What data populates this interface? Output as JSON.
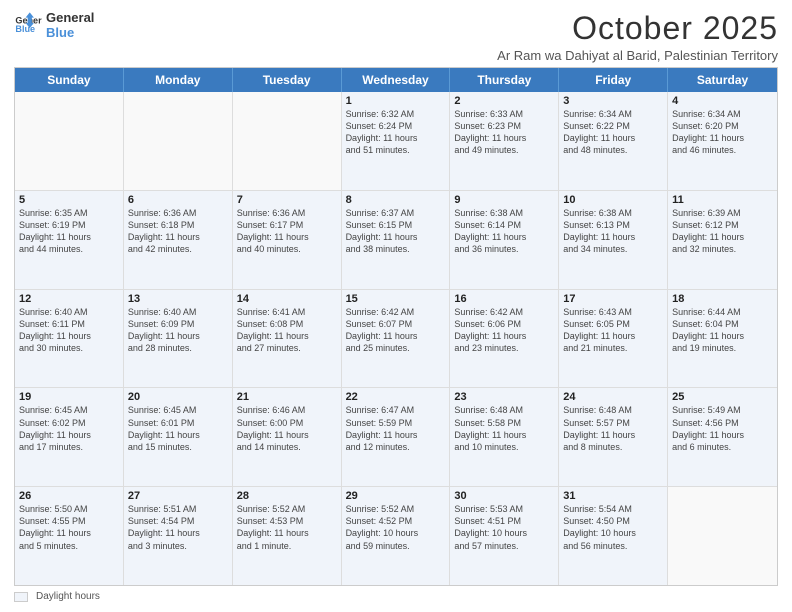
{
  "logo": {
    "line1": "General",
    "line2": "Blue"
  },
  "title": "October 2025",
  "subtitle": "Ar Ram wa Dahiyat al Barid, Palestinian Territory",
  "days_of_week": [
    "Sunday",
    "Monday",
    "Tuesday",
    "Wednesday",
    "Thursday",
    "Friday",
    "Saturday"
  ],
  "legend_label": "Daylight hours",
  "weeks": [
    [
      {
        "day": "",
        "info": "",
        "empty": true
      },
      {
        "day": "",
        "info": "",
        "empty": true
      },
      {
        "day": "",
        "info": "",
        "empty": true
      },
      {
        "day": "1",
        "info": "Sunrise: 6:32 AM\nSunset: 6:24 PM\nDaylight: 11 hours\nand 51 minutes.",
        "empty": false
      },
      {
        "day": "2",
        "info": "Sunrise: 6:33 AM\nSunset: 6:23 PM\nDaylight: 11 hours\nand 49 minutes.",
        "empty": false
      },
      {
        "day": "3",
        "info": "Sunrise: 6:34 AM\nSunset: 6:22 PM\nDaylight: 11 hours\nand 48 minutes.",
        "empty": false
      },
      {
        "day": "4",
        "info": "Sunrise: 6:34 AM\nSunset: 6:20 PM\nDaylight: 11 hours\nand 46 minutes.",
        "empty": false
      }
    ],
    [
      {
        "day": "5",
        "info": "Sunrise: 6:35 AM\nSunset: 6:19 PM\nDaylight: 11 hours\nand 44 minutes.",
        "empty": false
      },
      {
        "day": "6",
        "info": "Sunrise: 6:36 AM\nSunset: 6:18 PM\nDaylight: 11 hours\nand 42 minutes.",
        "empty": false
      },
      {
        "day": "7",
        "info": "Sunrise: 6:36 AM\nSunset: 6:17 PM\nDaylight: 11 hours\nand 40 minutes.",
        "empty": false
      },
      {
        "day": "8",
        "info": "Sunrise: 6:37 AM\nSunset: 6:15 PM\nDaylight: 11 hours\nand 38 minutes.",
        "empty": false
      },
      {
        "day": "9",
        "info": "Sunrise: 6:38 AM\nSunset: 6:14 PM\nDaylight: 11 hours\nand 36 minutes.",
        "empty": false
      },
      {
        "day": "10",
        "info": "Sunrise: 6:38 AM\nSunset: 6:13 PM\nDaylight: 11 hours\nand 34 minutes.",
        "empty": false
      },
      {
        "day": "11",
        "info": "Sunrise: 6:39 AM\nSunset: 6:12 PM\nDaylight: 11 hours\nand 32 minutes.",
        "empty": false
      }
    ],
    [
      {
        "day": "12",
        "info": "Sunrise: 6:40 AM\nSunset: 6:11 PM\nDaylight: 11 hours\nand 30 minutes.",
        "empty": false
      },
      {
        "day": "13",
        "info": "Sunrise: 6:40 AM\nSunset: 6:09 PM\nDaylight: 11 hours\nand 28 minutes.",
        "empty": false
      },
      {
        "day": "14",
        "info": "Sunrise: 6:41 AM\nSunset: 6:08 PM\nDaylight: 11 hours\nand 27 minutes.",
        "empty": false
      },
      {
        "day": "15",
        "info": "Sunrise: 6:42 AM\nSunset: 6:07 PM\nDaylight: 11 hours\nand 25 minutes.",
        "empty": false
      },
      {
        "day": "16",
        "info": "Sunrise: 6:42 AM\nSunset: 6:06 PM\nDaylight: 11 hours\nand 23 minutes.",
        "empty": false
      },
      {
        "day": "17",
        "info": "Sunrise: 6:43 AM\nSunset: 6:05 PM\nDaylight: 11 hours\nand 21 minutes.",
        "empty": false
      },
      {
        "day": "18",
        "info": "Sunrise: 6:44 AM\nSunset: 6:04 PM\nDaylight: 11 hours\nand 19 minutes.",
        "empty": false
      }
    ],
    [
      {
        "day": "19",
        "info": "Sunrise: 6:45 AM\nSunset: 6:02 PM\nDaylight: 11 hours\nand 17 minutes.",
        "empty": false
      },
      {
        "day": "20",
        "info": "Sunrise: 6:45 AM\nSunset: 6:01 PM\nDaylight: 11 hours\nand 15 minutes.",
        "empty": false
      },
      {
        "day": "21",
        "info": "Sunrise: 6:46 AM\nSunset: 6:00 PM\nDaylight: 11 hours\nand 14 minutes.",
        "empty": false
      },
      {
        "day": "22",
        "info": "Sunrise: 6:47 AM\nSunset: 5:59 PM\nDaylight: 11 hours\nand 12 minutes.",
        "empty": false
      },
      {
        "day": "23",
        "info": "Sunrise: 6:48 AM\nSunset: 5:58 PM\nDaylight: 11 hours\nand 10 minutes.",
        "empty": false
      },
      {
        "day": "24",
        "info": "Sunrise: 6:48 AM\nSunset: 5:57 PM\nDaylight: 11 hours\nand 8 minutes.",
        "empty": false
      },
      {
        "day": "25",
        "info": "Sunrise: 5:49 AM\nSunset: 4:56 PM\nDaylight: 11 hours\nand 6 minutes.",
        "empty": false
      }
    ],
    [
      {
        "day": "26",
        "info": "Sunrise: 5:50 AM\nSunset: 4:55 PM\nDaylight: 11 hours\nand 5 minutes.",
        "empty": false
      },
      {
        "day": "27",
        "info": "Sunrise: 5:51 AM\nSunset: 4:54 PM\nDaylight: 11 hours\nand 3 minutes.",
        "empty": false
      },
      {
        "day": "28",
        "info": "Sunrise: 5:52 AM\nSunset: 4:53 PM\nDaylight: 11 hours\nand 1 minute.",
        "empty": false
      },
      {
        "day": "29",
        "info": "Sunrise: 5:52 AM\nSunset: 4:52 PM\nDaylight: 10 hours\nand 59 minutes.",
        "empty": false
      },
      {
        "day": "30",
        "info": "Sunrise: 5:53 AM\nSunset: 4:51 PM\nDaylight: 10 hours\nand 57 minutes.",
        "empty": false
      },
      {
        "day": "31",
        "info": "Sunrise: 5:54 AM\nSunset: 4:50 PM\nDaylight: 10 hours\nand 56 minutes.",
        "empty": false
      },
      {
        "day": "",
        "info": "",
        "empty": true
      }
    ]
  ]
}
